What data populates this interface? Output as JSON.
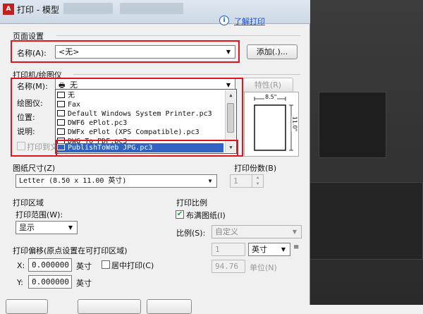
{
  "title": "打印 - 模型",
  "help": {
    "icon_text": "i",
    "link": "了解打印"
  },
  "page_setup": {
    "section": "页面设置",
    "name_label": "名称(A):",
    "name_value": "<无>",
    "add_button": "添加(.)..."
  },
  "printer": {
    "section": "打印机/绘图仪",
    "name_label": "名称(M):",
    "name_value": "无",
    "properties_button": "特性(R)",
    "plotter_label": "绘图仪:",
    "location_label": "位置:",
    "description_label": "说明:",
    "print_to_file_label": "打印到文件",
    "options": [
      "无",
      "Fax",
      "Default Windows System Printer.pc3",
      "DWF6 ePlot.pc3",
      "DWFx ePlot (XPS Compatible).pc3",
      "DWG To PDF.pc3",
      "PublishToWeb JPG.pc3"
    ],
    "selected_option": "PublishToWeb JPG.pc3",
    "preview": {
      "width_label": "8.5\"",
      "height_label": "11.0\""
    }
  },
  "paper_size": {
    "section": "图纸尺寸(Z)",
    "value": "Letter (8.50 x 11.00 英寸)"
  },
  "copies": {
    "section": "打印份数(B)",
    "value": "1"
  },
  "plot_area": {
    "section": "打印区域",
    "range_label": "打印范围(W):",
    "value": "显示"
  },
  "plot_offset": {
    "section": "打印偏移(原点设置在可打印区域)",
    "x_label": "X:",
    "x_value": "0.000000",
    "y_label": "Y:",
    "y_value": "0.000000",
    "unit": "英寸",
    "center_label": "居中打印(C)"
  },
  "plot_scale": {
    "section": "打印比例",
    "fit_label": "布满图纸(I)",
    "fit_checked": true,
    "scale_label": "比例(S):",
    "scale_value": "自定义",
    "value1": "1",
    "unit1": "英寸",
    "value2": "94.76",
    "unit2": "单位(N)"
  },
  "colors": {
    "accent": "#3163c4",
    "highlight": "#e0141e",
    "link": "#1b4fd0"
  }
}
